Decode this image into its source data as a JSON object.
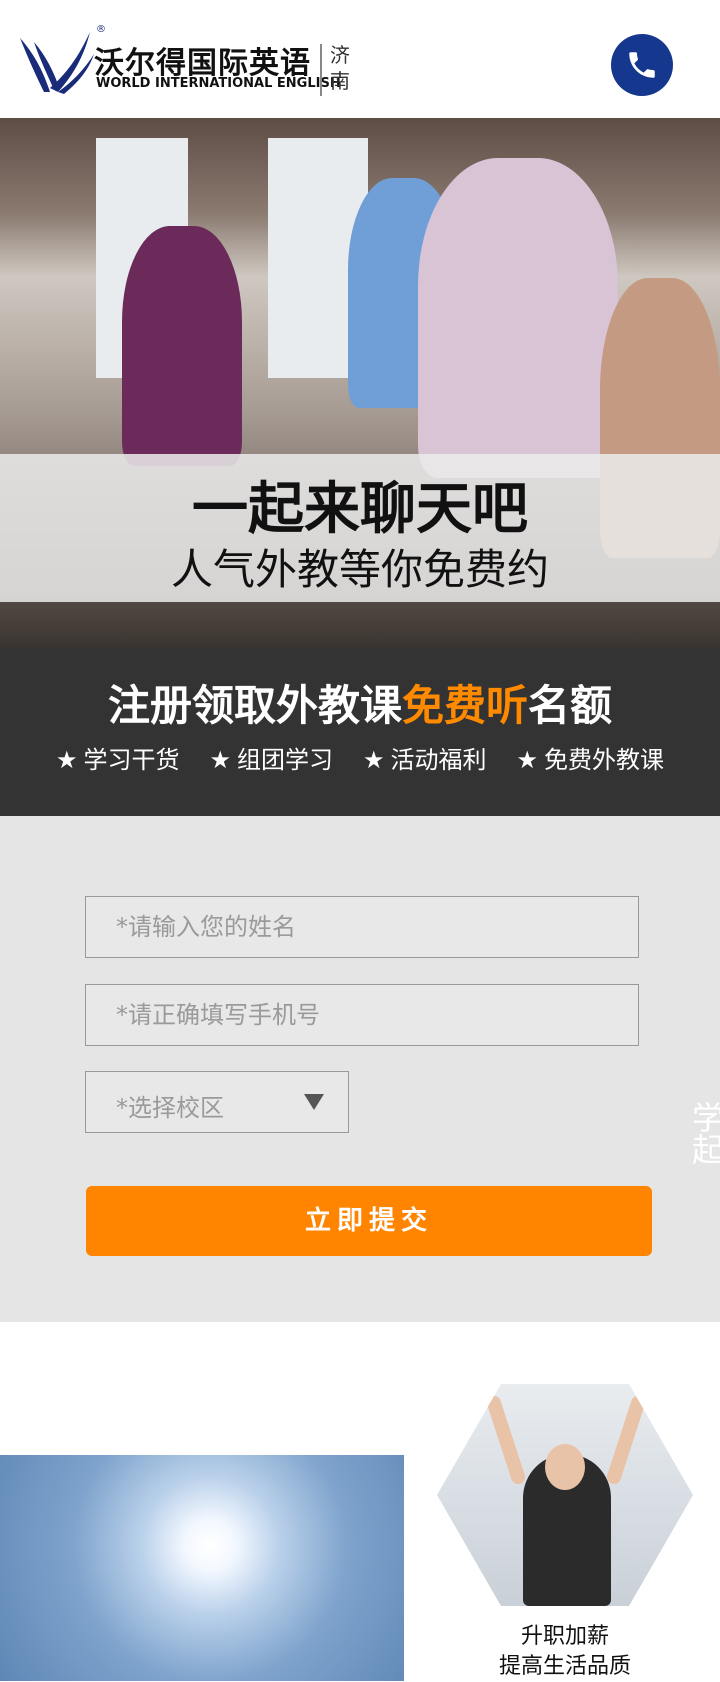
{
  "header": {
    "logo_cn": "沃尔得国际英语",
    "logo_en": "WORLD INTERNATIONAL ENGLISH",
    "logo_registered": "®",
    "city": "济南",
    "phone_icon": "phone-icon",
    "brand_color": "#15378d"
  },
  "hero": {
    "title": "一起来聊天吧",
    "subtitle": "人气外教等你免费约"
  },
  "promo": {
    "title_prefix": "注册领取外教课",
    "title_highlight": "免费听",
    "title_suffix": "名额",
    "highlight_color": "#ff8a00",
    "tags": [
      {
        "star": "★",
        "label": "学习干货"
      },
      {
        "star": "★",
        "label": "组团学习"
      },
      {
        "star": "★",
        "label": "活动福利"
      },
      {
        "star": "★",
        "label": "免费外教课"
      }
    ]
  },
  "form": {
    "name_placeholder": "*请输入您的姓名",
    "phone_placeholder": "*请正确填写手机号",
    "campus_select": "*选择校区",
    "submit_label": "立即提交",
    "submit_color": "#ff8400",
    "edge_text": "学起"
  },
  "bottom": {
    "caption_line1": "升职加薪",
    "caption_line2": "提高生活品质"
  }
}
